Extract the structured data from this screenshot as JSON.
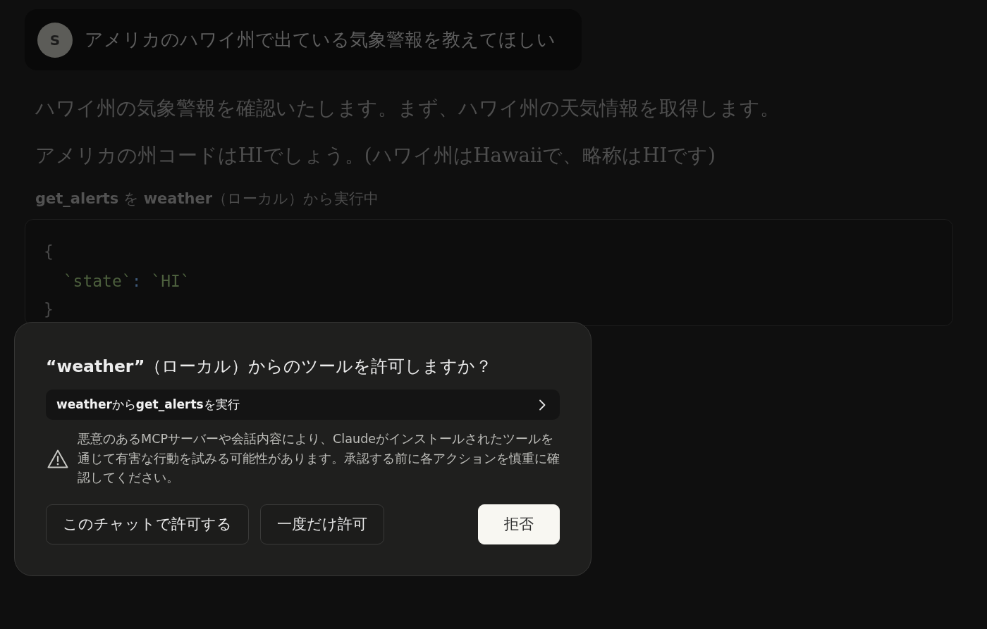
{
  "user_message": {
    "avatar_initial": "S",
    "text": "アメリカのハワイ州で出ている気象警報を教えてほしい"
  },
  "assistant": {
    "paragraphs": [
      "ハワイ州の気象警報を確認いたします。まず、ハワイ州の天気情報を取得します。",
      "アメリカの州コードはHIでしょう。(ハワイ州はHawaiiで、略称はHIです)"
    ],
    "tool_status": "**get_alerts** を **weather**（ローカル）から実行中",
    "code_block": {
      "open": "{",
      "entries": [
        {
          "key": "`state`",
          "separator": ":",
          "value": "`HI`"
        }
      ],
      "close": "}"
    }
  },
  "permission_dialog": {
    "title": "**“weather”**（ローカル）からのツールを許可しますか？",
    "tool_call": "**weather**から**get_alerts**を実行",
    "warning": "悪意のあるMCPサーバーや会話内容により、Claudeがインストールされたツールを通じて有害な行動を試みる可能性があります。承認する前に各アクションを慎重に確認してください。",
    "buttons": [
      {
        "label": "このチャットで許可する",
        "kind": "secondary"
      },
      {
        "label": "一度だけ許可",
        "kind": "secondary"
      },
      {
        "label": "拒否",
        "kind": "primary"
      }
    ]
  }
}
